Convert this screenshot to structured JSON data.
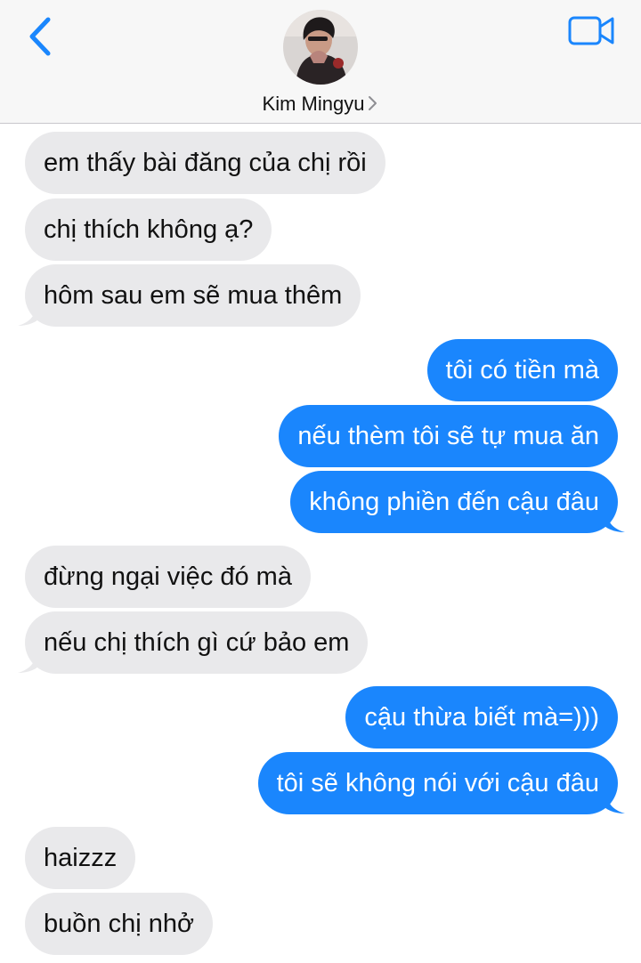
{
  "header": {
    "back_icon": "chevron-left-icon",
    "contact_name": "Kim Mingyu",
    "video_icon": "video-camera-icon",
    "accent_color": "#1a86fd"
  },
  "messages": [
    {
      "direction": "incoming",
      "text": "em thấy bài đăng của chị rồi"
    },
    {
      "direction": "incoming",
      "text": "chị thích không ạ?"
    },
    {
      "direction": "incoming",
      "text": "hôm sau em sẽ mua thêm"
    },
    {
      "direction": "outgoing",
      "text": "tôi có tiền mà"
    },
    {
      "direction": "outgoing",
      "text": "nếu thèm tôi sẽ tự mua ăn"
    },
    {
      "direction": "outgoing",
      "text": "không phiền đến cậu đâu"
    },
    {
      "direction": "incoming",
      "text": "đừng ngại việc đó mà"
    },
    {
      "direction": "incoming",
      "text": "nếu chị thích gì cứ bảo em"
    },
    {
      "direction": "outgoing",
      "text": "cậu thừa biết mà=)))"
    },
    {
      "direction": "outgoing",
      "text": "tôi sẽ không nói với cậu đâu"
    },
    {
      "direction": "incoming",
      "text": "haizzz"
    },
    {
      "direction": "incoming",
      "text": "buồn chị nhở"
    }
  ],
  "colors": {
    "incoming_bubble": "#e9e9eb",
    "outgoing_bubble": "#1a86fd"
  }
}
